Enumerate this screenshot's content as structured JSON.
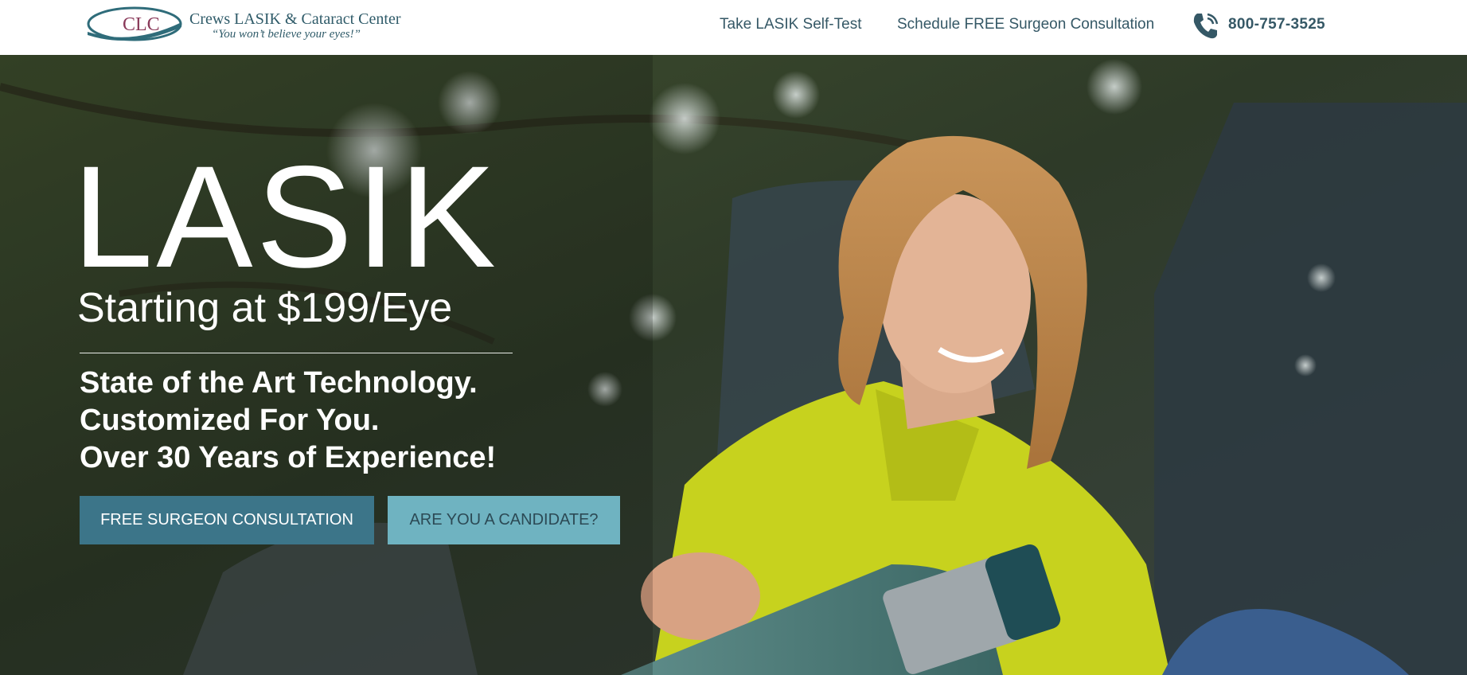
{
  "header": {
    "logo": {
      "mark_text": "CLC",
      "name": "Crews LASIK & Cataract Center",
      "tagline": "“You won’t believe your eyes!”"
    },
    "nav": {
      "self_test": "Take LASIK Self-Test",
      "consultation": "Schedule FREE Surgeon Consultation",
      "phone": "800-757-3525",
      "phone_icon": "phone-icon"
    }
  },
  "hero": {
    "title": "LASIK",
    "price": "Starting at $199/Eye",
    "lines": [
      "State of the Art Technology.",
      "Customized For You.",
      "Over 30 Years of Experience!"
    ],
    "buttons": {
      "consult": "FREE SURGEON CONSULTATION",
      "candidate": "ARE YOU A CANDIDATE?"
    }
  },
  "colors": {
    "brand_dark": "#355866",
    "button_primary": "#3c7589",
    "button_secondary": "#6fb3c1",
    "jacket": "#c7d21e"
  }
}
